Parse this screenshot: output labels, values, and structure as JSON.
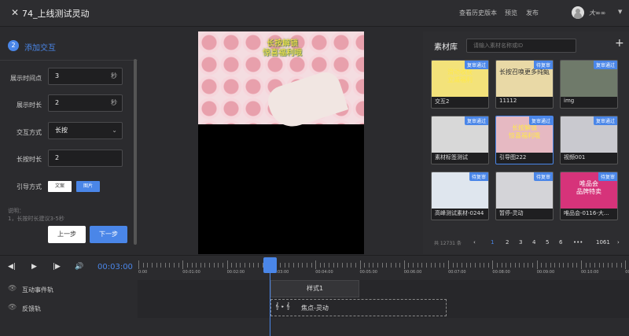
{
  "topbar": {
    "close_icon": "close-icon",
    "title": "74_上线测试灵动",
    "history": "查看历史版本",
    "preview": "预览",
    "publish": "发布",
    "username": "大∞∞"
  },
  "left": {
    "step_number": "2",
    "step_title": "添加交互",
    "fields": {
      "show_time_label": "展示时间点",
      "show_time_value": "3",
      "show_time_unit": "秒",
      "duration_label": "展示时长",
      "duration_value": "2",
      "duration_unit": "秒",
      "interaction_label": "交互方式",
      "interaction_value": "长按",
      "press_label": "长按时长",
      "press_value": "2",
      "guide_label": "引导方式",
      "guide_text": "文案",
      "guide_image": "图片"
    },
    "notes": {
      "title": "说明：",
      "line1": "1，长按时长建议3-5秒"
    },
    "prev_button": "上一步",
    "next_button": "下一步"
  },
  "preview": {
    "caption": "长按解锁\n惊喜福利哦"
  },
  "library": {
    "title": "素材库",
    "search_placeholder": "请输入素材名称或ID",
    "cards": [
      {
        "name": "交互2",
        "badge": "复审通过",
        "thumb_text": "滑动收获\n立减福利",
        "thumb_color": "#f3e27a"
      },
      {
        "name": "11112",
        "badge": "待复审",
        "thumb_text": "长按召唤更多纯甄",
        "thumb_color": "#e9d9a6"
      },
      {
        "name": "img",
        "badge": "复审通过",
        "thumb_text": "",
        "thumb_color": "#6f7a6a"
      },
      {
        "name": "素材标签测试",
        "badge": "复审通过",
        "thumb_text": "",
        "thumb_color": "#d8d8d8"
      },
      {
        "name": "引导图222",
        "badge": "复审通过",
        "thumb_text": "长按解锁\n惊喜福利哦",
        "thumb_color": "#e6b9c2"
      },
      {
        "name": "视频001",
        "badge": "复审通过",
        "thumb_text": "",
        "thumb_color": "#c9c9cf"
      },
      {
        "name": "高峰测试素材-0244",
        "badge": "待复审",
        "thumb_text": "",
        "thumb_color": "#dfe6ee"
      },
      {
        "name": "暂停-灵动",
        "badge": "待复审",
        "thumb_text": "",
        "thumb_color": "#d4d4d8"
      },
      {
        "name": "唯品会-0116-大...",
        "badge": "待复审",
        "thumb_text": "唯品会\n品牌特卖",
        "thumb_color": "#d6337a"
      }
    ],
    "pager": {
      "total": "共 12731 条",
      "prev_icon": "‹",
      "pages": [
        "1",
        "2",
        "3",
        "4",
        "5",
        "6",
        "•••",
        "1061"
      ],
      "next_icon": "›"
    }
  },
  "timeline": {
    "current_time": "00:03:00",
    "ticks": [
      "0:00",
      "00:01:00",
      "00:02:00",
      "00:03:00",
      "00:04:00",
      "00:05:00",
      "00:06:00",
      "00:07:00",
      "00:08:00",
      "00:09:00",
      "00:10:00",
      "00:11:00"
    ],
    "tracks": [
      {
        "name": "互动事件轨",
        "clip": "样式1"
      },
      {
        "name": "反馈轨",
        "clip": "焦点-灵动"
      }
    ]
  },
  "colors": {
    "accent": "#4a86e8",
    "background": "#2b2b2e"
  }
}
